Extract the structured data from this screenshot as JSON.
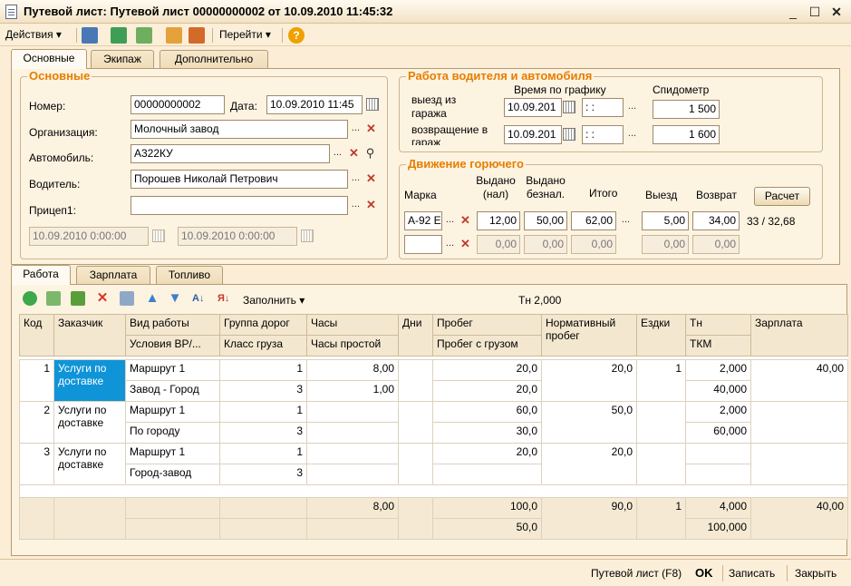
{
  "window": {
    "title": "Путевой лист: Путевой лист 00000000002 от 10.09.2010 11:45:32"
  },
  "toolbar": {
    "actions": "Действия",
    "goto": "Перейти"
  },
  "tabs": {
    "main": "Основные",
    "crew": "Экипаж",
    "extra": "Дополнительно"
  },
  "basic": {
    "title": "Основные",
    "number_label": "Номер:",
    "number": "00000000002",
    "date_label": "Дата:",
    "date": "10.09.2010 11:45",
    "org_label": "Организация:",
    "org": "Молочный завод",
    "car_label": "Автомобиль:",
    "car": "А322КУ",
    "driver_label": "Водитель:",
    "driver": "Порошев Николай Петрович",
    "trailer_label": "Прицеп1:",
    "trailer": "",
    "date_from": "10.09.2010  0:00:00",
    "date_to": "10.09.2010  0:00:00"
  },
  "work": {
    "title": "Работа водителя и автомобиля",
    "depart_label": "выезд из гаража",
    "return_label": "возвращение в гараж",
    "schedule_label": "Время по графику",
    "speedo_label": "Спидометр",
    "depart_date": "10.09.201",
    "depart_time": " :  :",
    "return_date": "10.09.201",
    "return_time": " :  :",
    "speedo_depart": "1 500",
    "speedo_return": "1 600"
  },
  "fuel": {
    "title": "Движение горючего",
    "brand_label": "Марка",
    "cash_label": "Выдано (нал)",
    "noncash_label": "Выдано безнал.",
    "total_label": "Итого",
    "exit_label": "Выезд",
    "return_label": "Возврат",
    "calc_button": "Расчет",
    "row1": {
      "brand": "А-92 Е",
      "cash": "12,00",
      "noncash": "50,00",
      "total": "62,00",
      "exit": "5,00",
      "ret": "34,00"
    },
    "row2": {
      "brand": "",
      "cash": "0,00",
      "noncash": "0,00",
      "total": "0,00",
      "exit": "0,00",
      "ret": "0,00"
    },
    "ratio": "33 / 32,68"
  },
  "bottom_tabs": {
    "work": "Работа",
    "salary": "Зарплата",
    "fuel": "Топливо"
  },
  "grid_toolbar": {
    "fill": "Заполнить",
    "tn_total": "Тн 2,000"
  },
  "grid": {
    "h1": [
      "Код",
      "Заказчик",
      "Вид работы",
      "Группа дорог",
      "Часы",
      "Дни",
      "Пробег",
      "Нормативный пробег",
      "Ездки",
      "Тн",
      "Зарплата"
    ],
    "h2": [
      "Условия ВР/...",
      "Класс груза",
      "Часы простой",
      "Пробег с грузом",
      "ТКМ"
    ],
    "rows": [
      {
        "code": "1",
        "customer": "Услуги по доставке",
        "a": [
          "Маршрут 1",
          "1",
          "8,00",
          "20,0",
          "20,0",
          "1",
          "2,000",
          "40,00"
        ],
        "b": [
          "Завод - Город",
          "3",
          "1,00",
          "20,0",
          "40,000"
        ]
      },
      {
        "code": "2",
        "customer": "Услуги по доставке",
        "a": [
          "Маршрут 1",
          "1",
          "60,0",
          "50,0",
          "2,000"
        ],
        "b": [
          "По городу",
          "3",
          "30,0",
          "60,000"
        ]
      },
      {
        "code": "3",
        "customer": "Услуги по доставке",
        "a": [
          "Маршрут 1",
          "1",
          "20,0",
          "20,0"
        ],
        "b": [
          "Город-завод",
          "3"
        ]
      }
    ],
    "totals": {
      "hours": "8,00",
      "mileage": "100,0",
      "norm": "90,0",
      "trips": "1",
      "tn": "4,000",
      "salary": "40,00",
      "cargo_mileage": "50,0",
      "tkm": "100,000"
    }
  },
  "statusbar": {
    "waybill": "Путевой лист (F8)",
    "ok": "OK",
    "save": "Записать",
    "close": "Закрыть"
  }
}
